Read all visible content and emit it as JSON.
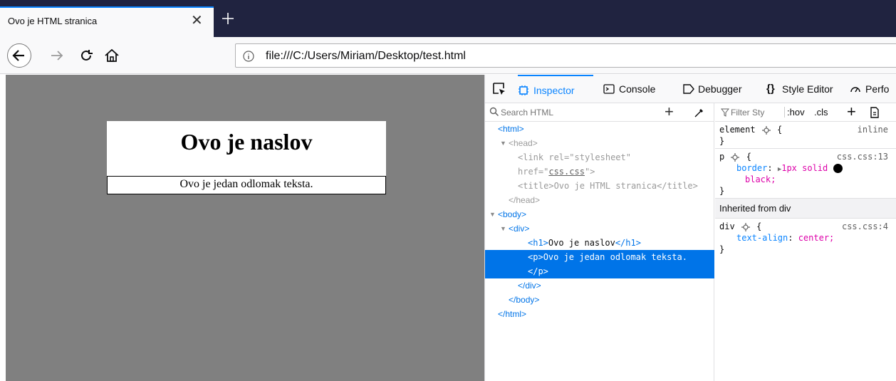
{
  "browser": {
    "tab_title": "Ovo je HTML stranica",
    "url": "file:///C:/Users/Miriam/Desktop/test.html"
  },
  "page": {
    "heading": "Ovo je naslov",
    "paragraph": "Ovo je jedan odlomak teksta."
  },
  "devtools": {
    "tabs": [
      "Inspector",
      "Console",
      "Debugger",
      "Style Editor",
      "Perfo"
    ],
    "search_placeholder": "Search HTML",
    "filter_placeholder": "Filter Sty",
    "hov_label": ":hov",
    "cls_label": ".cls",
    "markup": {
      "html_open": "<html>",
      "head_open": "<head>",
      "link_tag": "<link",
      "link_rel_attr": "rel=",
      "link_rel_val": "\"stylesheet\"",
      "link_href_attr": "href=",
      "link_href_val": "css.css",
      "title_open": "<title>",
      "title_text": "Ovo je HTML stranica",
      "title_close": "</title>",
      "head_close": "</head>",
      "body_open": "<body>",
      "div_open": "<div>",
      "h1_open": "<h1>",
      "h1_text": "Ovo je naslov",
      "h1_close": "</h1>",
      "p_open": "<p>",
      "p_text": "Ovo je jedan odlomak teksta.",
      "p_close": "</p>",
      "div_close": "</div>",
      "body_close": "</body>",
      "html_close": "</html>"
    },
    "rules": {
      "element_selector": "element",
      "element_source": "inline",
      "p_selector": "p",
      "p_source": "css.css:13",
      "p_prop": "border",
      "p_value": "1px solid",
      "p_value_2": "black;",
      "inherited_label": "Inherited from div",
      "div_selector": "div",
      "div_source": "css.css:4",
      "div_prop": "text-align",
      "div_value": "center;",
      "open_brace": "{",
      "close_brace": "}"
    }
  },
  "colors": {
    "accent": "#0a84ff",
    "tabstrip": "#202340",
    "page_background": "#808080"
  }
}
